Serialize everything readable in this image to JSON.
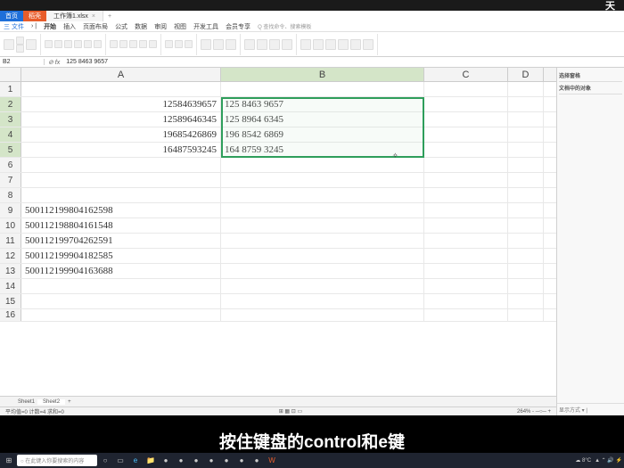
{
  "brand": "天",
  "tabs": {
    "t1": "首页",
    "t2": "稻壳",
    "file": "工作簿1.xlsx",
    "plus": "+"
  },
  "menu": {
    "file": "三 文件",
    "m1": "开始",
    "m2": "插入",
    "m3": "页面布局",
    "m4": "公式",
    "m5": "数据",
    "m6": "审阅",
    "m7": "视图",
    "m8": "开发工具",
    "m9": "会员专享",
    "search": "Q 查找命令、搜索模板"
  },
  "namebox": "B2",
  "formula": "125 8463 9657",
  "cols": {
    "A": "A",
    "B": "B",
    "C": "C",
    "D": "D"
  },
  "rows": [
    "1",
    "2",
    "3",
    "4",
    "5",
    "6",
    "7",
    "8",
    "9",
    "10",
    "11",
    "12",
    "13",
    "14",
    "15",
    "16"
  ],
  "cells": {
    "A2": "12584639657",
    "B2": "125 8463 9657",
    "A3": "12589646345",
    "B3": "125 8964 6345",
    "A4": "19685426869",
    "B4": "196 8542 6869",
    "A5": "16487593245",
    "B5": "164 8759 3245",
    "A9": "500112199804162598",
    "A10": "500112198804161548",
    "A11": "500112199704262591",
    "A12": "500112199904182585",
    "A13": "500112199904163688"
  },
  "panel": {
    "hdr1": "选择窗格",
    "hdr2": "文档中的对象",
    "bot": "显示方式 ▾  |"
  },
  "sheets": {
    "s1": "Sheet1",
    "s2": "Sheet2",
    "plus": "+"
  },
  "status": {
    "left": "平均值=0  计数=4  求和=0",
    "search": "○ 在此键入你要搜索的内容",
    "zoom": "264% - ─○─ +",
    "mid": "⊞ ▦ ⊡ ▭"
  },
  "subtitle": "按住键盘的control和e键",
  "taskbar": {
    "weather": "☁ 8°C",
    "time": "▲ ⌃ 🔊 ⚡"
  }
}
